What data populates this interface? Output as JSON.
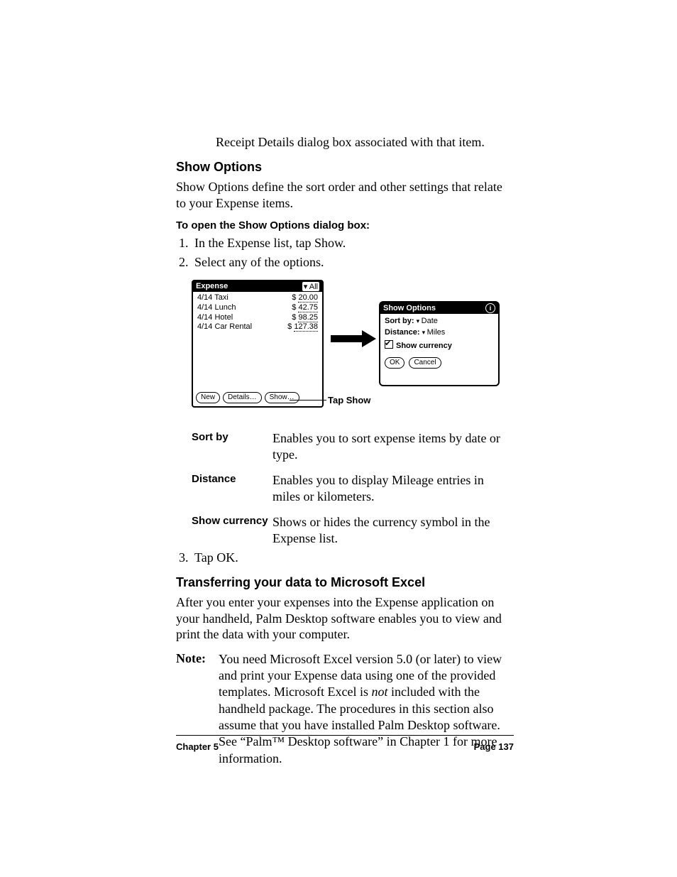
{
  "intro_line": "Receipt Details dialog box associated with that item.",
  "section1_title": "Show Options",
  "section1_body": "Show Options define the sort order and other settings that relate to your Expense items.",
  "howto_heading": "To open the Show Options dialog box:",
  "steps12": [
    "In the Expense list, tap Show.",
    "Select any of the options."
  ],
  "expense_screen": {
    "title": "Expense",
    "category": "All",
    "rows": [
      {
        "date": "4/14",
        "desc": "Taxi",
        "amt": "20.00"
      },
      {
        "date": "4/14",
        "desc": "Lunch",
        "amt": "42.75"
      },
      {
        "date": "4/14",
        "desc": "Hotel",
        "amt": "98.25"
      },
      {
        "date": "4/14",
        "desc": "Car Rental",
        "amt": "127.38"
      }
    ],
    "buttons": {
      "new": "New",
      "details": "Details…",
      "show": "Show…"
    }
  },
  "options_screen": {
    "title": "Show Options",
    "sort_label": "Sort by:",
    "sort_value": "Date",
    "distance_label": "Distance:",
    "distance_value": "Miles",
    "show_currency": "Show currency",
    "ok": "OK",
    "cancel": "Cancel"
  },
  "callout": "Tap Show",
  "defs": [
    {
      "term": "Sort by",
      "desc": "Enables you to sort expense items by date or type."
    },
    {
      "term": "Distance",
      "desc": "Enables you to display Mileage entries in miles or kilometers."
    },
    {
      "term": "Show currency",
      "desc": "Shows or hides the currency symbol in the Expense list."
    }
  ],
  "step3": "Tap OK.",
  "section2_title": "Transferring your data to Microsoft Excel",
  "section2_body": "After you enter your expenses into the Expense application on your handheld, Palm Desktop software enables you to view and print the data with your computer.",
  "note_label": "Note:",
  "note_body_pre": "You need Microsoft Excel version 5.0 (or later) to view and print your Expense data using one of the provided templates. Microsoft Excel is ",
  "note_body_em": "not",
  "note_body_post": " included with the handheld package. The procedures in this section also assume that you have installed Palm Desktop software. See “Palm™ Desktop software” in Chapter 1 for more information.",
  "footer_left": "Chapter 5",
  "footer_right": "Page 137"
}
